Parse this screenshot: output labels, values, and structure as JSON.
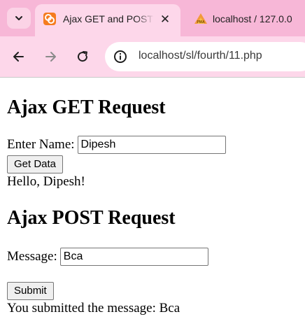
{
  "browser": {
    "tabs": [
      {
        "title": "Ajax GET and POST",
        "icon": "xampp-icon",
        "active": true
      },
      {
        "title": "localhost / 127.0.0",
        "icon": "phpmyadmin-icon",
        "active": false
      }
    ],
    "address_bar": {
      "url": "localhost/sl/fourth/11.php"
    },
    "colors": {
      "tabstrip": "#f7b7d7",
      "toolbar": "#fdd7ea"
    }
  },
  "page": {
    "get_section": {
      "heading": "Ajax GET Request",
      "name_label": "Enter Name:",
      "name_value": "Dipesh",
      "button_label": "Get Data",
      "result": "Hello, Dipesh!"
    },
    "post_section": {
      "heading": "Ajax POST Request",
      "message_label": "Message:",
      "message_value": "Bca",
      "button_label": "Submit",
      "result": "You submitted the message: Bca"
    }
  }
}
